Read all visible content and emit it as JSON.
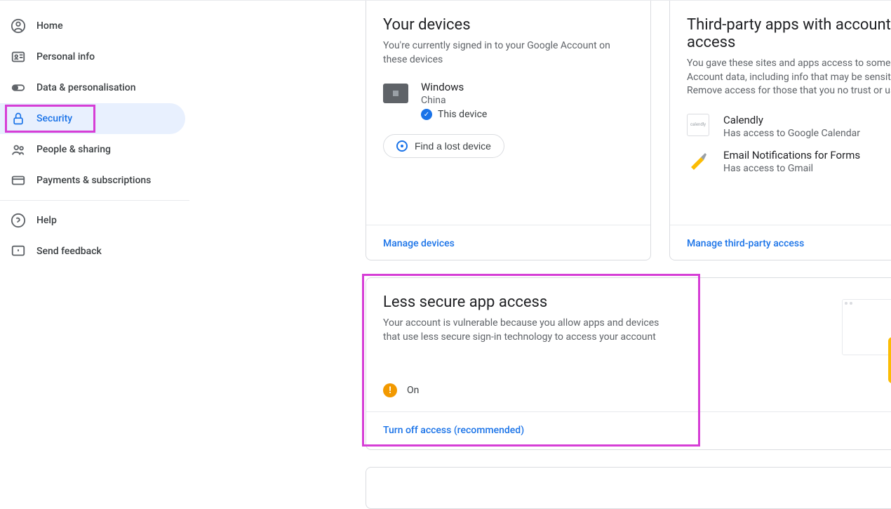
{
  "sidebar": {
    "items": [
      {
        "label": "Home"
      },
      {
        "label": "Personal info"
      },
      {
        "label": "Data & personalisation"
      },
      {
        "label": "Security"
      },
      {
        "label": "People & sharing"
      },
      {
        "label": "Payments & subscriptions"
      }
    ],
    "help": "Help",
    "feedback": "Send feedback"
  },
  "devices_card": {
    "title": "Your devices",
    "subtitle": "You're currently signed in to your Google Account on these devices",
    "device_name": "Windows",
    "device_location": "China",
    "this_device": "This device",
    "find_button": "Find a lost device",
    "manage": "Manage devices"
  },
  "thirdparty_card": {
    "title": "Third-party apps with account access",
    "subtitle": "You gave these sites and apps access to some Google Account data, including info that may be sensitive. Remove access for those that you no trust or use.",
    "apps": [
      {
        "name": "Calendly",
        "access": "Has access to Google Calendar",
        "icon_label": "calendly"
      },
      {
        "name": "Email Notifications for Forms",
        "access": "Has access to Gmail",
        "icon_label": "brush"
      }
    ],
    "manage": "Manage third-party access"
  },
  "less_secure_card": {
    "title": "Less secure app access",
    "subtitle": "Your account is vulnerable because you allow apps and devices that use less secure sign-in technology to access your account",
    "status": "On",
    "turn_off": "Turn off access (recommended)"
  }
}
